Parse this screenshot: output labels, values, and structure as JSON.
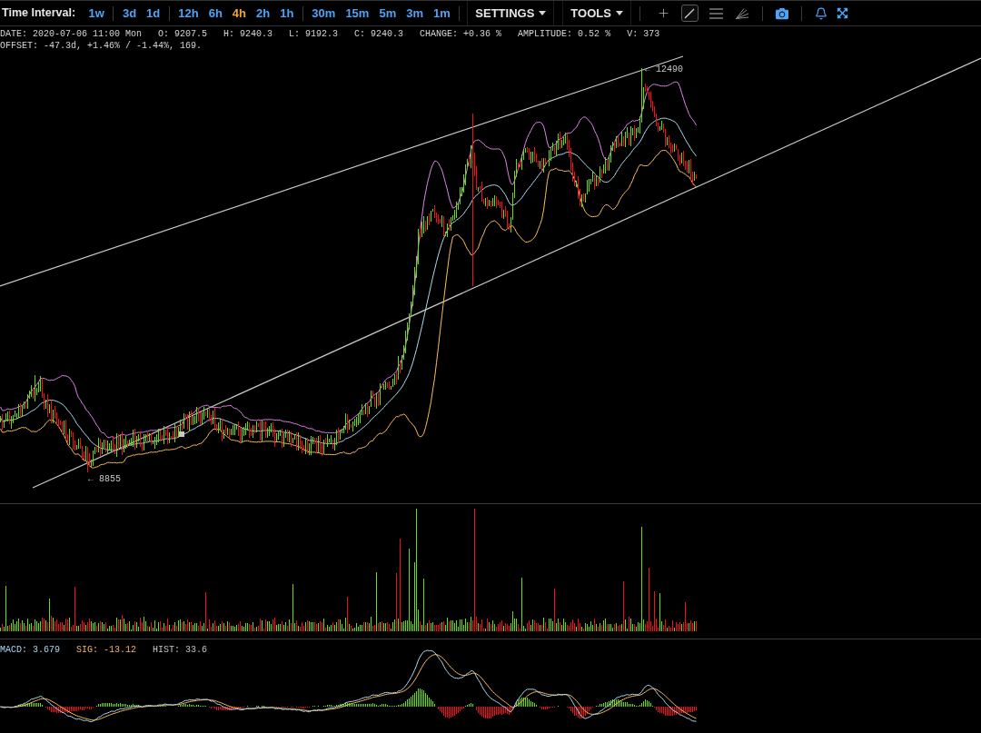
{
  "toolbar": {
    "title": "Time Interval:",
    "interval_groups": [
      {
        "intervals": [
          {
            "label": "1w",
            "selected": false
          }
        ]
      },
      {
        "intervals": [
          {
            "label": "3d",
            "selected": false
          },
          {
            "label": "1d",
            "selected": false
          }
        ]
      },
      {
        "intervals": [
          {
            "label": "12h",
            "selected": false
          },
          {
            "label": "6h",
            "selected": false
          },
          {
            "label": "4h",
            "selected": true
          },
          {
            "label": "2h",
            "selected": false
          },
          {
            "label": "1h",
            "selected": false
          }
        ]
      },
      {
        "intervals": [
          {
            "label": "30m",
            "selected": false
          },
          {
            "label": "15m",
            "selected": false
          },
          {
            "label": "5m",
            "selected": false
          },
          {
            "label": "3m",
            "selected": false
          },
          {
            "label": "1m",
            "selected": false
          }
        ]
      }
    ],
    "menus": [
      {
        "label": "SETTINGS"
      },
      {
        "label": "TOOLS"
      }
    ],
    "drawing_tools": [
      {
        "kind": "crosshair",
        "selected": false
      },
      {
        "kind": "trend_line",
        "selected": true
      },
      {
        "kind": "parallel_lines",
        "selected": false
      },
      {
        "kind": "fan",
        "selected": false
      }
    ],
    "action_groups": [
      {
        "actions": [
          {
            "kind": "camera"
          }
        ]
      },
      {
        "actions": [
          {
            "kind": "alert"
          },
          {
            "kind": "fullscreen"
          }
        ]
      }
    ]
  },
  "info": {
    "line_1": [
      "DATE: 2020-07-06 11:00 Mon",
      "O: 9207.5",
      "H: 9240.3",
      "L: 9192.3",
      "C: 9240.3",
      "CHANGE: +0.36 %",
      "AMPLITUDE: 0.52 %",
      "V: 373"
    ],
    "line_2": "OFFSET: -47.3d, +1.46% / -1.44%, 169."
  },
  "price_chart": {
    "annotations": [
      {
        "kind": "low",
        "text": "← 8855"
      },
      {
        "kind": "high",
        "text": "← 12490"
      }
    ]
  },
  "macd": {
    "readings": [
      {
        "text": "MACD: 3.679",
        "color": "#a9d4f0"
      },
      {
        "text": "SIG: -13.12",
        "color": "#f5b661"
      },
      {
        "text": "HIST: 33.6",
        "color": "#c4c4c4"
      }
    ]
  }
}
